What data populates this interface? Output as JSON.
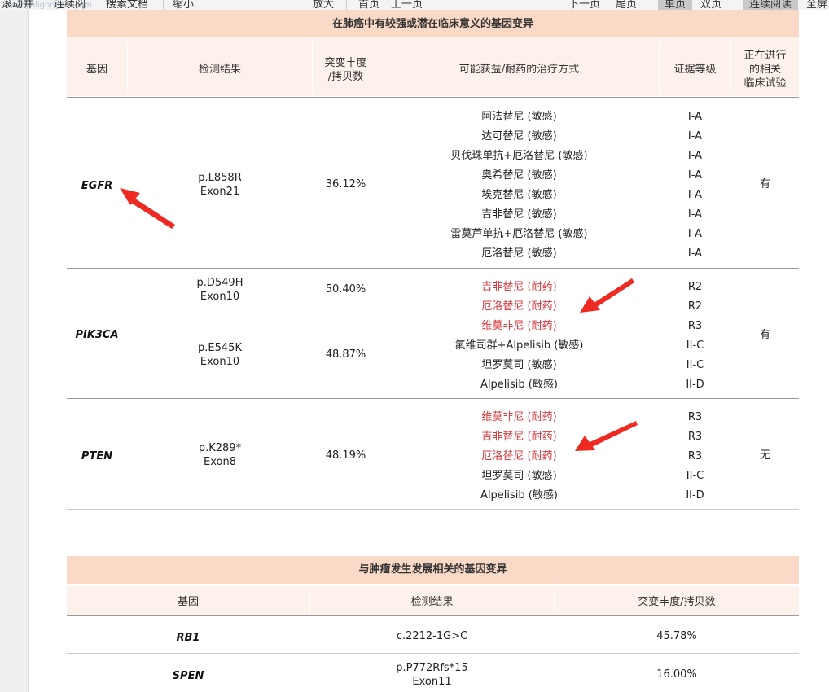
{
  "toolbar": {
    "watermark": "www.yuligongwu.com",
    "items": [
      "滚动并",
      "连续阅",
      "搜索文档",
      "缩小",
      "放大",
      "首页",
      "上一页",
      "下一页",
      "尾页",
      "单页",
      "双页",
      "连续阅读",
      "全屏"
    ]
  },
  "table1": {
    "title": "在肺癌中有较强或潜在临床意义的基因变异",
    "headers": {
      "gene": "基因",
      "result": "检测结果",
      "vaf": [
        "突变丰度",
        "/拷贝数"
      ],
      "therapy": "可能获益/耐药的治疗方式",
      "level": "证据等级",
      "trial": [
        "正在进行",
        "的相关",
        "临床试验"
      ]
    },
    "rows": [
      {
        "gene": "EGFR",
        "results": [
          {
            "mutation": "p.L858R",
            "exon": "Exon21",
            "vaf": "36.12%"
          }
        ],
        "therapies": [
          {
            "drug": "阿法替尼 (敏感)",
            "level": "I-A",
            "resistant": false
          },
          {
            "drug": "达可替尼 (敏感)",
            "level": "I-A",
            "resistant": false
          },
          {
            "drug": "贝伐珠单抗+厄洛替尼 (敏感)",
            "level": "I-A",
            "resistant": false
          },
          {
            "drug": "奥希替尼 (敏感)",
            "level": "I-A",
            "resistant": false
          },
          {
            "drug": "埃克替尼 (敏感)",
            "level": "I-A",
            "resistant": false
          },
          {
            "drug": "吉非替尼 (敏感)",
            "level": "I-A",
            "resistant": false
          },
          {
            "drug": "雷莫芦单抗+厄洛替尼 (敏感)",
            "level": "I-A",
            "resistant": false
          },
          {
            "drug": "厄洛替尼 (敏感)",
            "level": "I-A",
            "resistant": false
          }
        ],
        "trial": "有"
      },
      {
        "gene": "PIK3CA",
        "results": [
          {
            "mutation": "p.D549H",
            "exon": "Exon10",
            "vaf": "50.40%"
          },
          {
            "mutation": "p.E545K",
            "exon": "Exon10",
            "vaf": "48.87%"
          }
        ],
        "therapies": [
          {
            "drug": "吉非替尼 (耐药)",
            "level": "R2",
            "resistant": true
          },
          {
            "drug": "厄洛替尼 (耐药)",
            "level": "R2",
            "resistant": true
          },
          {
            "drug": "维莫非尼 (耐药)",
            "level": "R3",
            "resistant": true
          },
          {
            "drug": "氟维司群+Alpelisib (敏感)",
            "level": "II-C",
            "resistant": false
          },
          {
            "drug": "坦罗莫司 (敏感)",
            "level": "II-C",
            "resistant": false
          },
          {
            "drug": "Alpelisib (敏感)",
            "level": "II-D",
            "resistant": false
          }
        ],
        "trial": "有"
      },
      {
        "gene": "PTEN",
        "results": [
          {
            "mutation": "p.K289*",
            "exon": "Exon8",
            "vaf": "48.19%"
          }
        ],
        "therapies": [
          {
            "drug": "维莫非尼 (耐药)",
            "level": "R3",
            "resistant": true
          },
          {
            "drug": "吉非替尼 (耐药)",
            "level": "R3",
            "resistant": true
          },
          {
            "drug": "厄洛替尼 (耐药)",
            "level": "R3",
            "resistant": true
          },
          {
            "drug": "坦罗莫司 (敏感)",
            "level": "II-C",
            "resistant": false
          },
          {
            "drug": "Alpelisib (敏感)",
            "level": "II-D",
            "resistant": false
          }
        ],
        "trial": "无"
      }
    ]
  },
  "table2": {
    "title": "与肿瘤发生发展相关的基因变异",
    "headers": {
      "gene": "基因",
      "result": "检测结果",
      "vaf": "突变丰度/拷贝数"
    },
    "rows": [
      {
        "gene": "RB1",
        "result": [
          "c.2212-1G>C"
        ],
        "vaf": "45.78%"
      },
      {
        "gene": "SPEN",
        "result": [
          "p.P772Rfs*15",
          "Exon11"
        ],
        "vaf": "16.00%"
      }
    ]
  },
  "colors": {
    "header_band": "#fbd9c7",
    "subheader_band": "#fdf1eb",
    "resistant_text": "#d9343a",
    "annotation_arrow": "#ee2a22"
  }
}
